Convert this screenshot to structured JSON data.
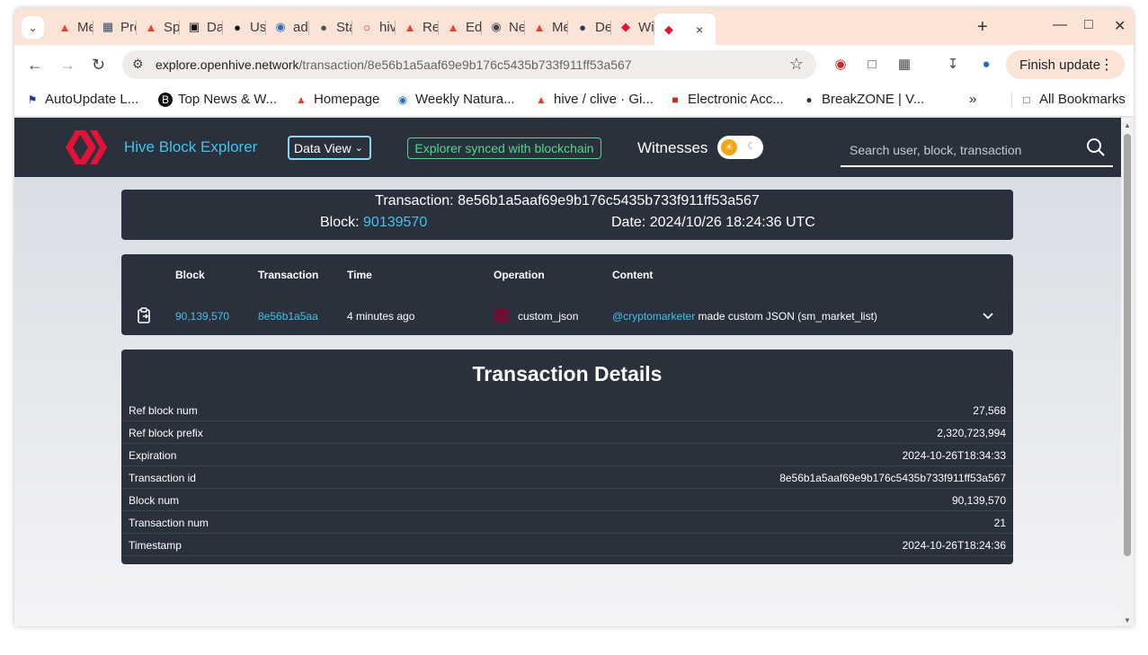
{
  "browser": {
    "tabs": [
      {
        "label": "Me",
        "icon": "gitlab-icon"
      },
      {
        "label": "Pro",
        "icon": "grid-icon"
      },
      {
        "label": "Spe",
        "icon": "gitlab-icon"
      },
      {
        "label": "Dat",
        "icon": "db-icon"
      },
      {
        "label": "Use",
        "icon": "github-icon"
      },
      {
        "label": "adr",
        "icon": "app-icon"
      },
      {
        "label": "Sta",
        "icon": "globe-icon"
      },
      {
        "label": "hive",
        "icon": "chat-icon"
      },
      {
        "label": "Rel",
        "icon": "gitlab-icon"
      },
      {
        "label": "Edi",
        "icon": "gitlab-icon"
      },
      {
        "label": "Nev",
        "icon": "chrome-icon"
      },
      {
        "label": "Me",
        "icon": "gitlab-icon"
      },
      {
        "label": "Der",
        "icon": "globe-icon"
      },
      {
        "label": "Wit",
        "icon": "hive-icon"
      }
    ],
    "active_tab_close": "×",
    "new_tab": "+",
    "url_host": "explore.openhive.network",
    "url_path": "/transaction/8e56b1a5aaf69e9b176c5435b733f911ff53a567",
    "finish_update": "Finish update",
    "bookmarks": [
      {
        "label": "AutoUpdate L..."
      },
      {
        "label": "Top News & W..."
      },
      {
        "label": "Homepage"
      },
      {
        "label": "Weekly Natura..."
      },
      {
        "label": "hive / clive · Gi..."
      },
      {
        "label": "Electronic Acc..."
      },
      {
        "label": "BreakZONE | V..."
      }
    ],
    "all_bookmarks": "All Bookmarks"
  },
  "site": {
    "title": "Hive Block Explorer",
    "data_view": "Data View",
    "synced": "Explorer synced with blockchain",
    "witnesses": "Witnesses",
    "search_placeholder": "Search user, block, transaction",
    "brand_color": "#e31337",
    "accent_color": "#42c3ea"
  },
  "transaction": {
    "title_label": "Transaction:",
    "hash": "8e56b1a5aaf69e9b176c5435b733f911ff53a567",
    "block_label": "Block:",
    "block": "90139570",
    "date_label": "Date:",
    "date": "2024/10/26 18:24:36 UTC"
  },
  "operations": {
    "headers": {
      "block": "Block",
      "transaction": "Transaction",
      "time": "Time",
      "operation": "Operation",
      "content": "Content"
    },
    "row": {
      "block": "90,139,570",
      "transaction": "8e56b1a5aa",
      "time": "4 minutes ago",
      "operation": "custom_json",
      "operation_color": "#6c0f35",
      "content_user": "@cryptomarketer",
      "content_text": "made custom JSON (sm_market_list)"
    }
  },
  "details": {
    "title": "Transaction Details",
    "rows": [
      {
        "key": "Ref block num",
        "value": "27,568"
      },
      {
        "key": "Ref block prefix",
        "value": "2,320,723,994"
      },
      {
        "key": "Expiration",
        "value": "2024-10-26T18:34:33"
      },
      {
        "key": "Transaction id",
        "value": "8e56b1a5aaf69e9b176c5435b733f911ff53a567"
      },
      {
        "key": "Block num",
        "value": "90,139,570"
      },
      {
        "key": "Transaction num",
        "value": "21"
      },
      {
        "key": "Timestamp",
        "value": "2024-10-26T18:24:36"
      }
    ]
  }
}
